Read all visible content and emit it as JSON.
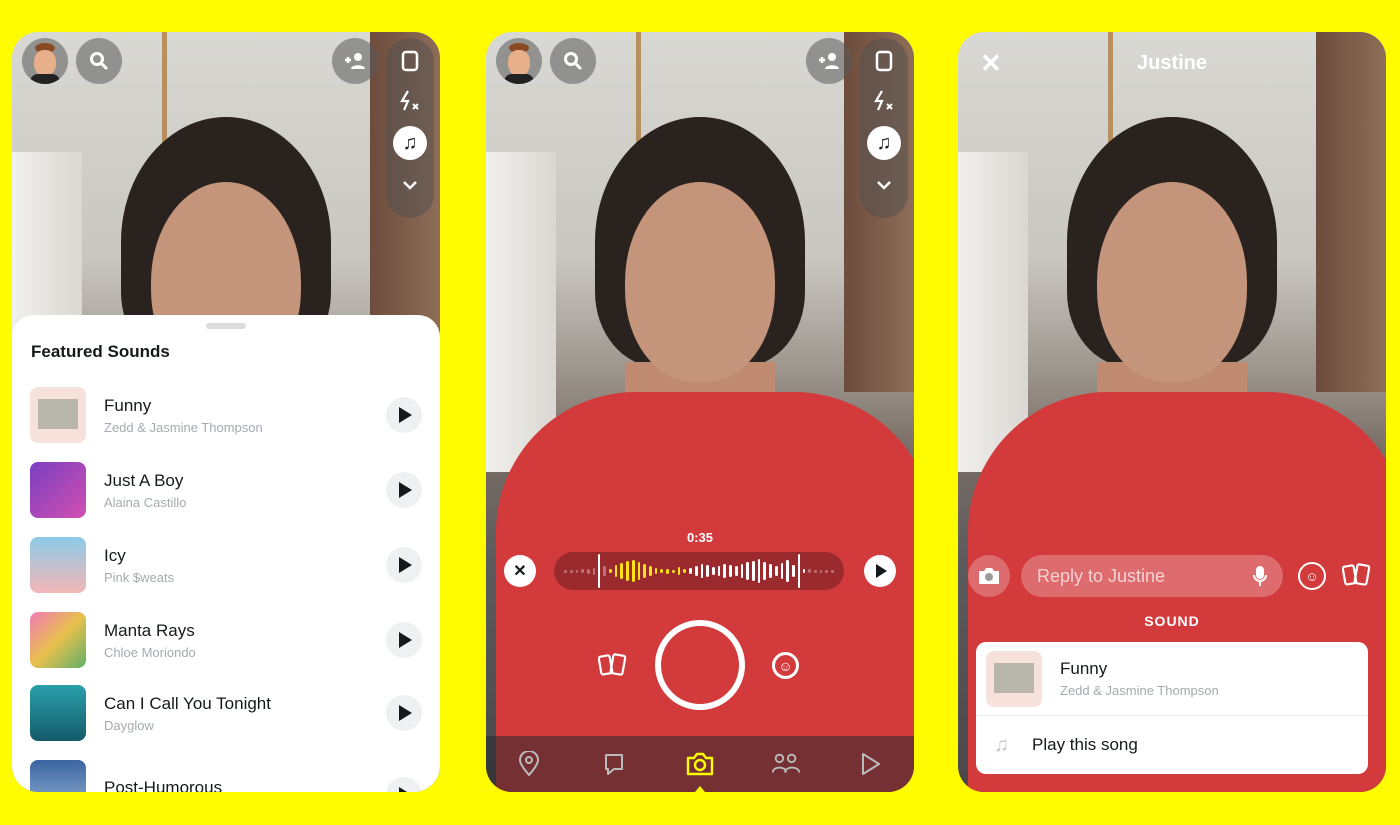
{
  "colors": {
    "brand": "#FFFC00",
    "accent_yellow": "#FFFC00",
    "text_primary": "#16191C",
    "text_secondary": "#A5AAB0"
  },
  "phone1": {
    "top_icons": [
      "bitmoji-avatar",
      "search-icon",
      "add-friend-icon"
    ],
    "sidebar": [
      "flip-camera-icon",
      "flash-off-icon",
      "music-icon",
      "chevron-down-icon"
    ],
    "sheet_title": "Featured Sounds",
    "tracks": [
      {
        "title": "Funny",
        "artist": "Zedd & Jasmine Thompson",
        "art": "#f6e2da"
      },
      {
        "title": "Just A Boy",
        "artist": "Alaina Castillo",
        "art": "#a43fb5"
      },
      {
        "title": "Icy",
        "artist": "Pink $weats",
        "art": "#9fd0ea"
      },
      {
        "title": "Manta Rays",
        "artist": "Chloe Moriondo",
        "art": "#f080b8"
      },
      {
        "title": "Can I Call You Tonight",
        "artist": "Dayglow",
        "art": "#2a96a2"
      },
      {
        "title": "Post-Humorous",
        "artist": "",
        "art": "#3a64a0"
      }
    ]
  },
  "phone2": {
    "sidebar": [
      "flip-camera-icon",
      "flash-off-icon",
      "music-icon",
      "chevron-down-icon"
    ],
    "clip_duration": "0:35",
    "nav": [
      "map-icon",
      "chat-icon",
      "camera-icon",
      "friends-icon",
      "stories-icon"
    ],
    "active_nav": "camera-icon"
  },
  "phone3": {
    "title": "Justine",
    "reply_placeholder": "Reply to Justine",
    "section_label": "SOUND",
    "sound": {
      "title": "Funny",
      "artist": "Zedd & Jasmine Thompson"
    },
    "action_label": "Play this song"
  }
}
